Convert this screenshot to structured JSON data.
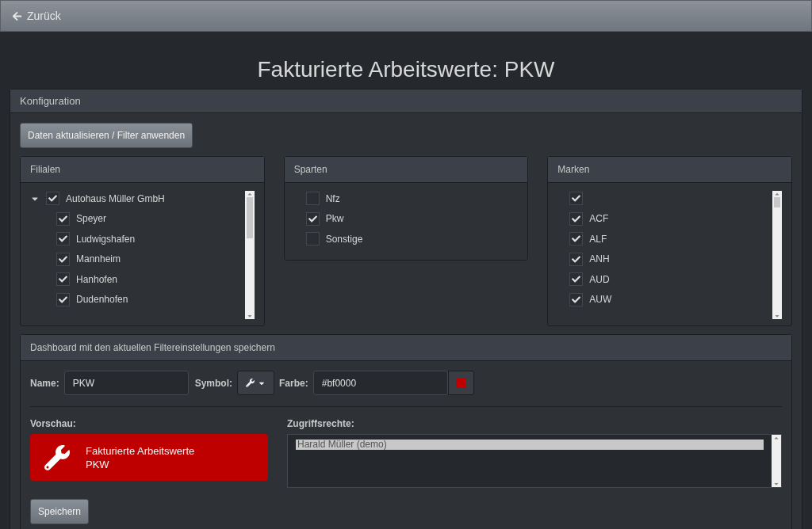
{
  "topbar": {
    "back_label": "Zurück"
  },
  "title": "Fakturierte Arbeitswerte: PKW",
  "config": {
    "title": "Konfiguration",
    "apply_button": "Daten aktualisieren / Filter anwenden",
    "filialen": {
      "title": "Filialen",
      "items": [
        {
          "label": "Autohaus Müller GmbH",
          "checked": true,
          "expanded": true,
          "children": [
            {
              "label": "Speyer",
              "checked": true
            },
            {
              "label": "Ludwigshafen",
              "checked": true
            },
            {
              "label": "Mannheim",
              "checked": true
            },
            {
              "label": "Hanhofen",
              "checked": true
            },
            {
              "label": "Dudenhofen",
              "checked": true
            }
          ]
        }
      ]
    },
    "sparten": {
      "title": "Sparten",
      "items": [
        {
          "label": "Nfz",
          "checked": false
        },
        {
          "label": "Pkw",
          "checked": true
        },
        {
          "label": "Sonstige",
          "checked": false
        }
      ]
    },
    "marken": {
      "title": "Marken",
      "items": [
        {
          "checked": true
        },
        {
          "label": "ACF",
          "checked": true
        },
        {
          "label": "ALF",
          "checked": true
        },
        {
          "label": "ANH",
          "checked": true
        },
        {
          "label": "AUD",
          "checked": true
        },
        {
          "label": "AUW",
          "checked": true
        }
      ]
    }
  },
  "dashboard": {
    "title": "Dashboard mit den aktuellen Filtereinstellungen speichern",
    "name_label": "Name:",
    "name_value": "PKW",
    "symbol_label": "Symbol:",
    "color_label": "Farbe:",
    "color_value": "#bf0000",
    "preview_label": "Vorschau:",
    "preview_lines": [
      "Fakturierte Arbeitswerte",
      "PKW"
    ],
    "access_label": "Zugriffsrechte:",
    "access_items": [
      {
        "label": "Harald Müller (demo)",
        "selected": true
      }
    ],
    "save_button": "Speichern"
  }
}
